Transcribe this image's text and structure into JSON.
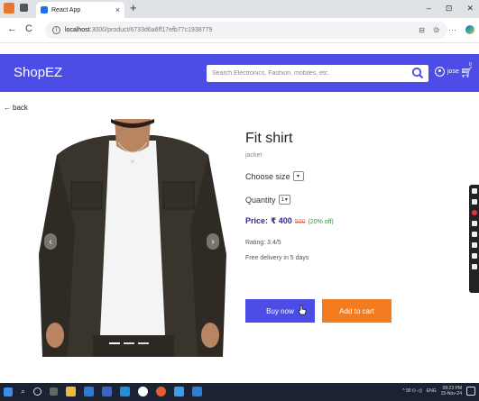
{
  "browser": {
    "tab_title": "React App",
    "tab_close": "×",
    "new_tab": "+",
    "window_controls": [
      "–",
      "⊡",
      "✕"
    ],
    "url_host": "localhost",
    "url_path": ":3000/product/6733d6a6ff17efb77c1938779",
    "nav": [
      "←",
      "C"
    ]
  },
  "navbar": {
    "brand": "ShopEZ",
    "search_placeholder": "Search Electronics, Fashion, mobiles, etc.",
    "user_name": "jose",
    "cart_count": "0"
  },
  "back_label": "back",
  "product": {
    "title": "Fit shirt",
    "category": "jacket",
    "size_label": "Choose size",
    "quantity_label": "Quantity",
    "quantity_value": "1",
    "price_label": "Price:",
    "price": "₹ 400",
    "old_price": "500",
    "discount": "(20% off)",
    "rating": "Rating: 3.4/5",
    "delivery": "Free delivery in 5 days"
  },
  "carousel": {
    "prev": "‹",
    "next": "›"
  },
  "buttons": {
    "buy_now": "Buy now",
    "add_to_cart": "Add to cart"
  },
  "taskbar": {
    "lang": "ENG",
    "time": "09:23 PM",
    "date": "15-Nov-24",
    "sys": "^ 90 ⏻ ◁)"
  },
  "colors": {
    "primary": "#4c4ce6",
    "cart_button": "#f47c20",
    "discount": "#3d8f3d",
    "old_price": "#e64444"
  }
}
